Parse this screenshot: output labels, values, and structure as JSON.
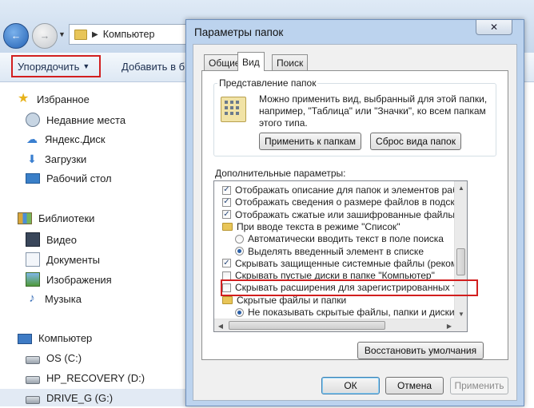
{
  "explorer": {
    "breadcrumb": [
      "Компьютер"
    ],
    "toolbar": {
      "organize_label": "Упорядочить",
      "add_label": "Добавить в б"
    },
    "nav": {
      "favorites": "Избранное",
      "recent": "Недавние места",
      "yandex_disk": "Яндекс.Диск",
      "downloads": "Загрузки",
      "desktop": "Рабочий стол",
      "libraries": "Библиотеки",
      "video": "Видео",
      "documents": "Документы",
      "images": "Изображения",
      "music": "Музыка",
      "computer": "Компьютер",
      "os_drive": "OS (C:)",
      "recovery_drive": "HP_RECOVERY (D:)",
      "drive_g": "DRIVE_G (G:)"
    }
  },
  "dialog": {
    "title": "Параметры папок",
    "close_glyph": "✕",
    "tabs": [
      "Общие",
      "Вид",
      "Поиск"
    ],
    "active_tab": "Вид",
    "folder_views": {
      "group_title": "Представление папок",
      "description": "Можно применить вид, выбранный для этой папки, например, \"Таблица\" или \"Значки\", ко всем папкам этого типа.",
      "apply_button": "Применить к папкам",
      "reset_button": "Сброс вида папок"
    },
    "advanced": {
      "label": "Дополнительные параметры:",
      "items": [
        {
          "kind": "checkbox",
          "checked": true,
          "indent": 1,
          "text": "Отображать описание для папок и элементов рабочего стола"
        },
        {
          "kind": "checkbox",
          "checked": true,
          "indent": 1,
          "text": "Отображать сведения о размере файлов в подсказках папок"
        },
        {
          "kind": "checkbox",
          "checked": true,
          "indent": 1,
          "text": "Отображать сжатые или зашифрованные файлы NTFS другим цветом"
        },
        {
          "kind": "folder",
          "indent": 1,
          "text": "При вводе текста в режиме \"Список\""
        },
        {
          "kind": "radio",
          "checked": false,
          "indent": 2,
          "text": "Автоматически вводить текст в поле поиска"
        },
        {
          "kind": "radio",
          "checked": true,
          "indent": 2,
          "text": "Выделять введенный элемент в списке"
        },
        {
          "kind": "checkbox",
          "checked": true,
          "indent": 1,
          "text": "Скрывать защищенные системные файлы (рекомендуется)"
        },
        {
          "kind": "checkbox",
          "checked": false,
          "indent": 1,
          "text": "Скрывать пустые диски в папке \"Компьютер\""
        },
        {
          "kind": "checkbox",
          "checked": false,
          "indent": 1,
          "text": "Скрывать расширения для зарегистрированных типов файлов"
        },
        {
          "kind": "folder",
          "indent": 1,
          "text": "Скрытые файлы и папки"
        },
        {
          "kind": "radio",
          "checked": true,
          "indent": 2,
          "text": "Не показывать скрытые файлы, папки и диски"
        }
      ]
    },
    "restore_button": "Восстановить умолчания",
    "ok_button": "ОК",
    "cancel_button": "Отмена",
    "apply_button": "Применить"
  }
}
